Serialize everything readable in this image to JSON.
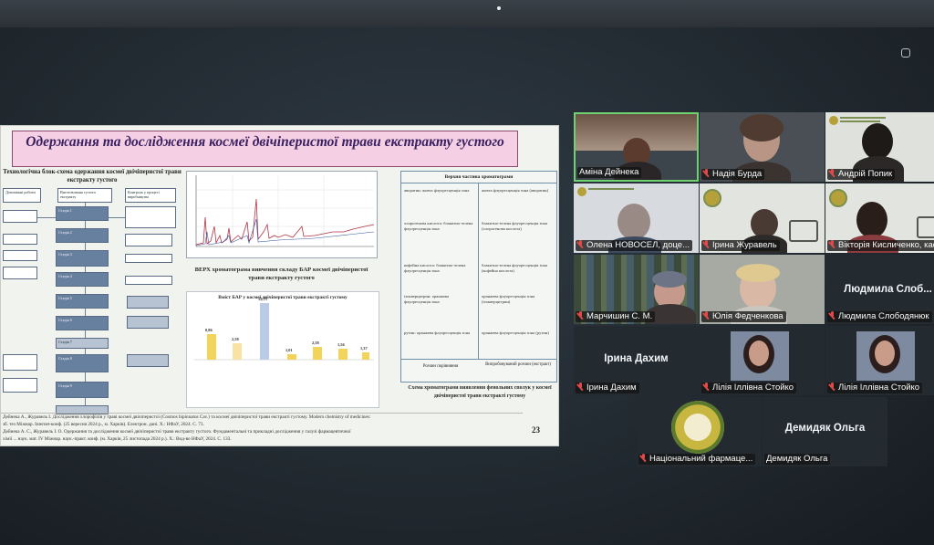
{
  "slide": {
    "title": "Одержання та дослідження космеї двічіперистої трави екстракту густого",
    "scheme_heading": "Технологічна блок-схема одержання космеї двічіперистої трави екстракту густого",
    "flow_headers": [
      "Допоміжні роботи",
      "Виготовлення густого екстракту",
      "Контроль у процесі виробництва"
    ],
    "flow_stages": [
      "Стадія 1",
      "Стадія 2",
      "Стадія 3",
      "Стадія 4",
      "Стадія 5",
      "Стадія 6",
      "Стадія 7",
      "Стадія 8",
      "Стадія 9"
    ],
    "chromatogram_caption": "ВЕРХ хроматограма вивчення складу БАР космеї двічіперистої трави екстракту густого",
    "bar_chart_title": "Вміст БАР у космеї двічіперистої трави екстракті густому",
    "bar_values": [
      "0,86",
      "2,58",
      "12,75",
      "1,01",
      "2,58",
      "1,56",
      "1,37"
    ],
    "table_header": "Верхня частина хроматограми",
    "table_rows": [
      {
        "c1": "аворатин: жовта флуоресценція зона",
        "c2": "жовта флуоресценція зона (аворатин)"
      },
      {
        "c1": "хлорогенова кислота: блакитно-зелена флуоресценція зона",
        "c2": "блакитно-зелена флуоресценція зона (хлорогенова кислота)"
      },
      {
        "c1": "кофейна кислота: блакитно-зелена флуоресценція зона",
        "c2": "блакитно-зелена флуоресценція зона (кофейна кислота)"
      },
      {
        "c1": "ізокверцитрин: оранжева флуоресценція зона",
        "c2": "оранжева флуоресценція зона (ізокверцитрин)"
      },
      {
        "c1": "рутин: оранжева флуоресценція зона",
        "c2": "оранжева флуоресценція зона (рутин)"
      }
    ],
    "table_footer": [
      "Розчин порівняння",
      "Випробовуваний розчин (екстракт)"
    ],
    "table_caption": "Схема хроматограми виявлення фенольних сполук у космеї двічіперистої трави екстракті густому",
    "refs": [
      "Дейнека А., Журавель І. Дослідження хлорофілів у траві космеї двічіперистої (Cosmos bipinnatus Cav.) та космеї двічіперистої трави екстракті густому. Modern chemistry of medicines:",
      "зб. тез Міжнар. Internet-конф. (25 вересня 2024 р., м. Харків). Електрон. дані. Х.: НФаУ, 2024. С. 73.",
      "Дейнека А. С., Журавель І. О. Одержання та дослідження космеї двічіперистої трави екстракту густого. Фундаментальні та прикладні дослідження у галузі фармацевтичної",
      "хімії ... наук. мат. IV Міжнар. наук.-практ. конф. (м. Харків, 25 листопада 2024 р.). Х.: Вид-во НФаУ, 2024. С. 133."
    ],
    "page_number": "23"
  },
  "participants": [
    {
      "name": "Аміна Дейнека",
      "muted": false,
      "active": true
    },
    {
      "name": "Надія Бурда",
      "muted": true
    },
    {
      "name": "Андрій Попик",
      "muted": true
    },
    {
      "name": "Олена НОВОСЕЛ, доце...",
      "muted": true
    },
    {
      "name": "Ірина Журавель",
      "muted": true
    },
    {
      "name": "Вікторія Кисличенко, кафе...",
      "muted": true
    },
    {
      "name": "Марчишин С. М.",
      "muted": true
    },
    {
      "name": "Юлія Федченкова",
      "muted": true
    },
    {
      "name": "Людмила Слободянюк",
      "big": "Людмила  Слоб...",
      "muted": true
    },
    {
      "name": "Ірина Дахим",
      "big": "Ірина Дахим",
      "muted": true
    },
    {
      "name": "Лілія Іллівна Стойко",
      "muted": true
    },
    {
      "name": "Лілія Іллівна Стойко",
      "muted": true
    },
    {
      "name": "Національний фармаце...",
      "muted": true
    },
    {
      "name": "Демидяк Ольга",
      "big": "Демидяк Ольга",
      "muted": true
    }
  ],
  "colors": {
    "active_border": "#6fd16f",
    "muted_icon": "#e24a4a",
    "slide_title_bg": "#f5cfe4"
  }
}
